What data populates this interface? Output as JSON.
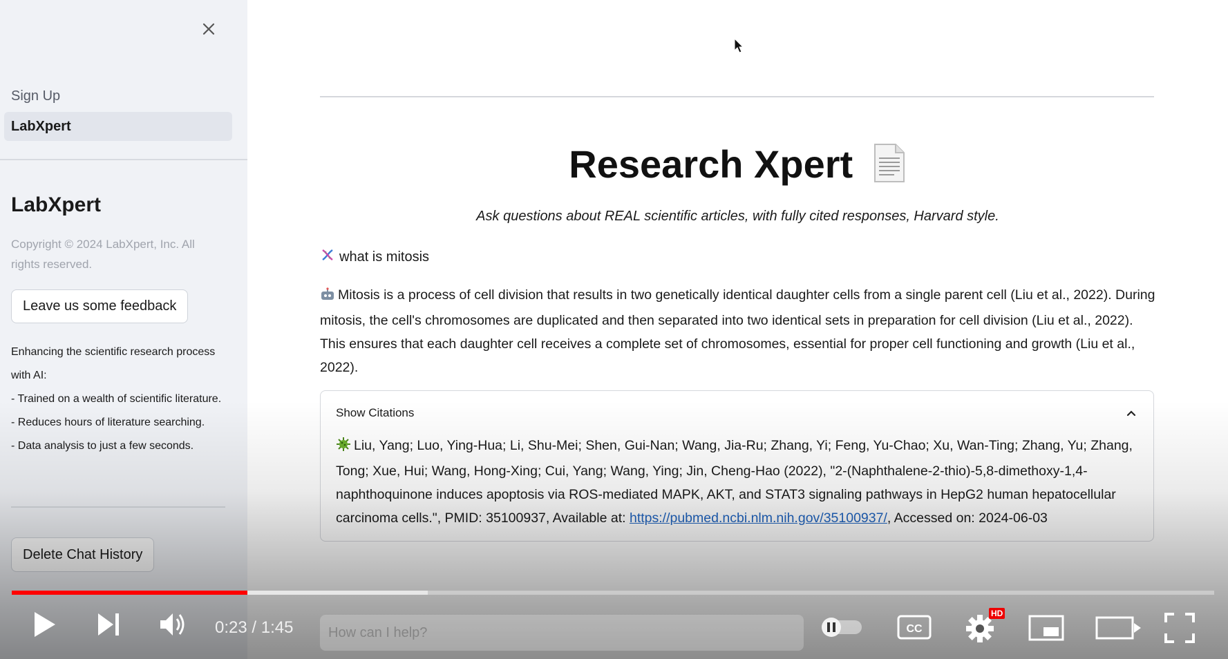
{
  "sidebar": {
    "close_icon": "close-icon",
    "nav": [
      {
        "label": "Sign Up",
        "active": false
      },
      {
        "label": "LabXpert",
        "active": true
      }
    ],
    "brand": "LabXpert",
    "copyright": "Copyright © 2024 LabXpert, Inc. All rights reserved.",
    "feedback_label": "Leave us some feedback",
    "description": [
      "Enhancing the scientific research process with AI:",
      "- Trained on a wealth of scientific literature.",
      "- Reduces hours of literature searching.",
      "- Data analysis to just a few seconds."
    ],
    "delete_label": "Delete Chat History"
  },
  "main": {
    "title": "Research Xpert",
    "title_icon": "document-icon",
    "subtitle": "Ask questions about REAL scientific articles, with fully cited responses, Harvard style.",
    "question": {
      "icon": "dna-icon",
      "text": "what is mitosis"
    },
    "answer": {
      "icon": "robot-icon",
      "text": "Mitosis is a process of cell division that results in two genetically identical daughter cells from a single parent cell (Liu et al., 2022). During mitosis, the cell's chromosomes are duplicated and then separated into two identical sets in preparation for cell division (Liu et al., 2022). This ensures that each daughter cell receives a complete set of chromosomes, essential for proper cell functioning and growth (Liu et al., 2022)."
    },
    "citations": {
      "header": "Show Citations",
      "icon": "microbe-icon",
      "text_before": "Liu, Yang; Luo, Ying-Hua; Li, Shu-Mei; Shen, Gui-Nan; Wang, Jia-Ru; Zhang, Yi; Feng, Yu-Chao; Xu, Wan-Ting; Zhang, Yu; Zhang, Tong; Xue, Hui; Wang, Hong-Xing; Cui, Yang; Wang, Ying; Jin, Cheng-Hao (2022), \"2-(Naphthalene-2-thio)-5,8-dimethoxy-1,4-naphthoquinone induces apoptosis via ROS-mediated MAPK, AKT, and STAT3 signaling pathways in HepG2 human hepatocellular carcinoma cells.\", PMID: 35100937, Available at: ",
      "link": "https://pubmed.ncbi.nlm.nih.gov/35100937/",
      "text_after": ", Accessed on: 2024-06-03"
    }
  },
  "player": {
    "time": "0:23 / 1:45",
    "chat_placeholder": "How can I help?",
    "played_fraction": 0.196,
    "buffered_fraction": 0.346,
    "hd_badge": "HD",
    "colors": {
      "progress": "#ff0000",
      "badge": "#e00000"
    }
  }
}
